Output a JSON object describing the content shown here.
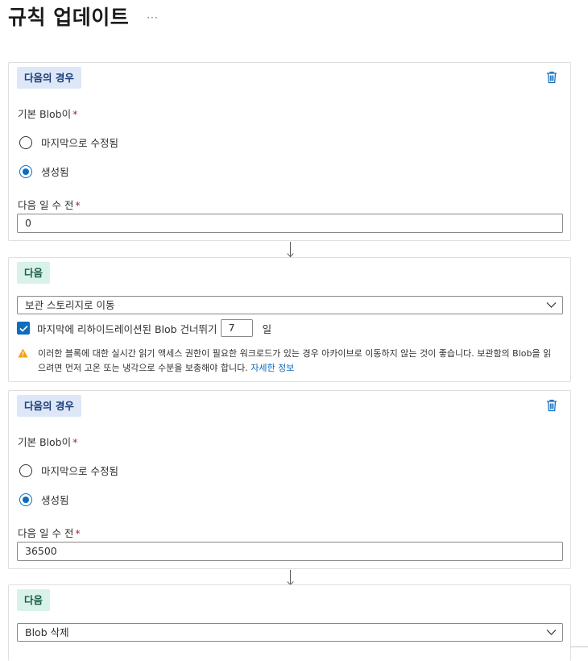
{
  "header": {
    "title": "규칙 업데이트",
    "more_label": "···"
  },
  "blocks": [
    {
      "tag": "다음의 경우",
      "base_blob_label": "기본 Blob이",
      "radio_options": [
        "마지막으로 수정됨",
        "생성됨"
      ],
      "selected": "생성됨",
      "days_label": "다음 일 수 전",
      "days_value": "0"
    },
    {
      "tag": "다음",
      "action": "보관 스토리지로 이동",
      "skip_checked": true,
      "skip_label": "마지막에 리하이드레이션된 Blob 건너뛰기",
      "skip_days": "7",
      "skip_unit": "일",
      "warning_text": "이러한 블록에 대한 실시간 읽기 액세스 권한이 필요한 워크로드가 있는 경우 아카이브로 이동하지 않는 것이 좋습니다. 보관함의 Blob을 읽으려면 먼저 고온 또는 냉각으로 수분을 보충해야 합니다.",
      "warning_link": "자세한 정보"
    },
    {
      "tag": "다음의 경우",
      "base_blob_label": "기본 Blob이",
      "radio_options": [
        "마지막으로 수정됨",
        "생성됨"
      ],
      "selected": "생성됨",
      "days_label": "다음 일 수 전",
      "days_value": "36500"
    },
    {
      "tag": "다음",
      "action": "Blob 삭제"
    }
  ],
  "required_mark": "*",
  "icons": {
    "delete": "trash-icon",
    "arrow": "down-arrow-icon",
    "chevron": "chevron-down-icon",
    "warning": "warning-icon"
  },
  "colors": {
    "accent": "#0f6cbd",
    "warning": "#f2a20c",
    "if_tag_bg": "#dde7f7",
    "then_tag_bg": "#d8f2ea"
  }
}
